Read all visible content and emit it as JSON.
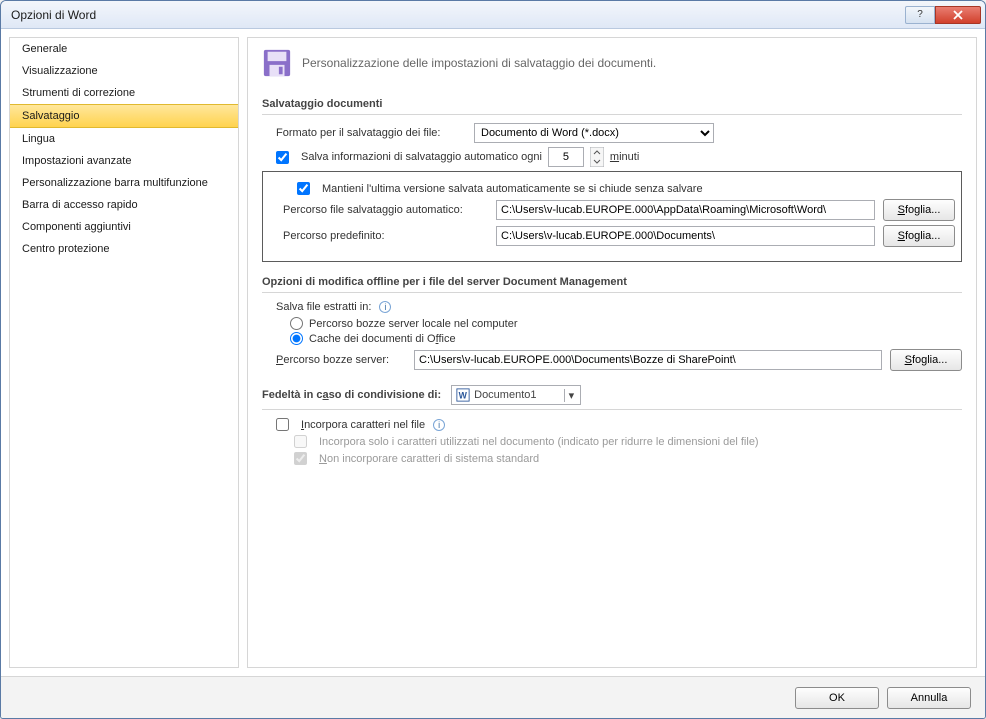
{
  "window": {
    "title": "Opzioni di Word"
  },
  "sidebar": {
    "items": [
      "Generale",
      "Visualizzazione",
      "Strumenti di correzione",
      "Salvataggio",
      "Lingua",
      "Impostazioni avanzate",
      "Personalizzazione barra multifunzione",
      "Barra di accesso rapido",
      "Componenti aggiuntivi",
      "Centro protezione"
    ],
    "selected_index": 3
  },
  "header": {
    "text": "Personalizzazione delle impostazioni di salvataggio dei documenti."
  },
  "sections": {
    "save_docs": {
      "title": "Salvataggio documenti",
      "format_label": "Formato per il salvataggio dei file:",
      "format_value": "Documento di Word (*.docx)",
      "autosave_chk_label_pre": "Salva informazioni di salvataggio automatico ogni",
      "autosave_value": "5",
      "autosave_unit": "minuti",
      "keep_last_label": "Mantieni l'ultima versione salvata automaticamente se si chiude senza salvare",
      "autorecover_label": "Percorso file salvataggio automatico:",
      "autorecover_path": "C:\\Users\\v-lucab.EUROPE.000\\AppData\\Roaming\\Microsoft\\Word\\",
      "default_label": "Percorso predefinito:",
      "default_path": "C:\\Users\\v-lucab.EUROPE.000\\Documents\\",
      "browse": "Sfoglia..."
    },
    "offline": {
      "title": "Opzioni di modifica offline per i file del server Document Management",
      "save_extracted_label": "Salva file estratti in:",
      "radio_local": "Percorso bozze server locale nel computer",
      "radio_cache_pre": "Cache dei documenti di O",
      "radio_cache_mid": "f",
      "radio_cache_post": "fice",
      "drafts_label": "Percorso bozze server:",
      "drafts_path": "C:\\Users\\v-lucab.EUROPE.000\\Documents\\Bozze di SharePoint\\",
      "browse": "Sfoglia..."
    },
    "fidelity": {
      "title_pre": "Fedeltà in c",
      "title_ul": "a",
      "title_post": "so di condivisione di:",
      "doc_name": "Documento1",
      "embed_label": "Incorpora caratteri nel file",
      "embed_used_label": "Incorpora solo i caratteri utilizzati nel documento (indicato per ridurre le dimensioni del file)",
      "embed_nosys_pre": "N",
      "embed_nosys_post": "on incorporare caratteri di sistema standard"
    }
  },
  "footer": {
    "ok": "OK",
    "cancel": "Annulla"
  }
}
